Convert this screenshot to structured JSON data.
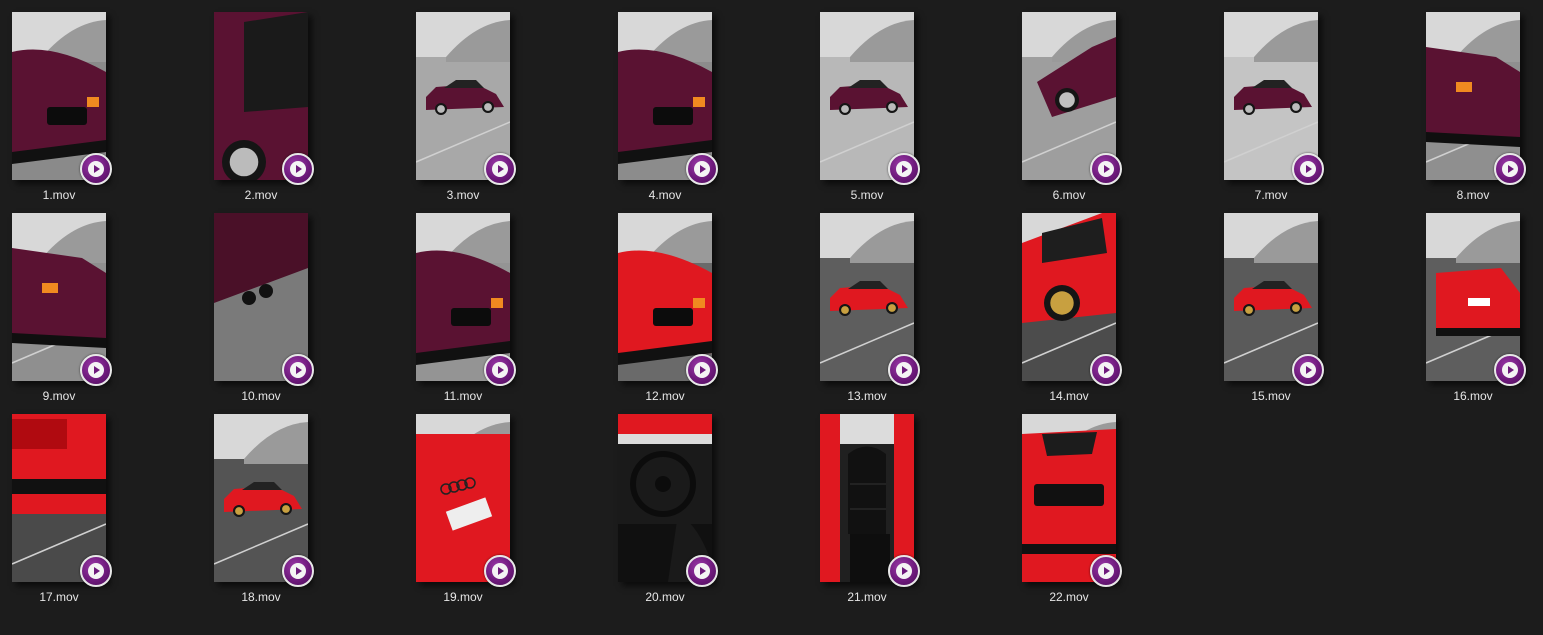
{
  "files": [
    {
      "name": "1.mov",
      "scene": "bmw-front",
      "car": "#5a1232",
      "bg": "#8a8a8a"
    },
    {
      "name": "2.mov",
      "scene": "bmw-door",
      "car": "#5a1232",
      "bg": "#9a9a9a"
    },
    {
      "name": "3.mov",
      "scene": "bmw-far",
      "car": "#5a1232",
      "bg": "#a8a8a8"
    },
    {
      "name": "4.mov",
      "scene": "bmw-front",
      "car": "#5a1232",
      "bg": "#8c8c8c"
    },
    {
      "name": "5.mov",
      "scene": "bmw-far",
      "car": "#5a1232",
      "bg": "#b8b8b8"
    },
    {
      "name": "6.mov",
      "scene": "bmw-tilt",
      "car": "#5a1232",
      "bg": "#9e9e9e"
    },
    {
      "name": "7.mov",
      "scene": "bmw-far",
      "car": "#5a1232",
      "bg": "#c4c4c4"
    },
    {
      "name": "8.mov",
      "scene": "bmw-rear",
      "car": "#5a1232",
      "bg": "#8f8f8f"
    },
    {
      "name": "9.mov",
      "scene": "bmw-rear",
      "car": "#5a1232",
      "bg": "#8f8f8f"
    },
    {
      "name": "10.mov",
      "scene": "bmw-exhaust",
      "car": "#4a1028",
      "bg": "#7c7c7c"
    },
    {
      "name": "11.mov",
      "scene": "bmw-front",
      "car": "#5a1232",
      "bg": "#949494"
    },
    {
      "name": "12.mov",
      "scene": "audi-front",
      "car": "#e01820",
      "bg": "#6a6a6a"
    },
    {
      "name": "13.mov",
      "scene": "audi-far",
      "car": "#e01820",
      "bg": "#5e5e5e"
    },
    {
      "name": "14.mov",
      "scene": "audi-side",
      "car": "#e01820",
      "bg": "#4c4c4c"
    },
    {
      "name": "15.mov",
      "scene": "audi-far",
      "car": "#e01820",
      "bg": "#5a5a5a"
    },
    {
      "name": "16.mov",
      "scene": "audi-rear",
      "car": "#e01820",
      "bg": "#5e5e5e"
    },
    {
      "name": "17.mov",
      "scene": "audi-tail",
      "car": "#e01820",
      "bg": "#4a4a4a"
    },
    {
      "name": "18.mov",
      "scene": "audi-far",
      "car": "#e01820",
      "bg": "#545454"
    },
    {
      "name": "19.mov",
      "scene": "audi-plate",
      "car": "#e01820",
      "bg": "#2a2a2a"
    },
    {
      "name": "20.mov",
      "scene": "interior",
      "car": "#e01820",
      "bg": "#1a1a1a"
    },
    {
      "name": "21.mov",
      "scene": "seat",
      "car": "#e01820",
      "bg": "#202020"
    },
    {
      "name": "22.mov",
      "scene": "audi-grille",
      "car": "#e01820",
      "bg": "#505050"
    }
  ],
  "colors": {
    "background": "#1c1c1c",
    "label_text": "#e6e6e6",
    "play_badge": "#6e1a7c"
  }
}
